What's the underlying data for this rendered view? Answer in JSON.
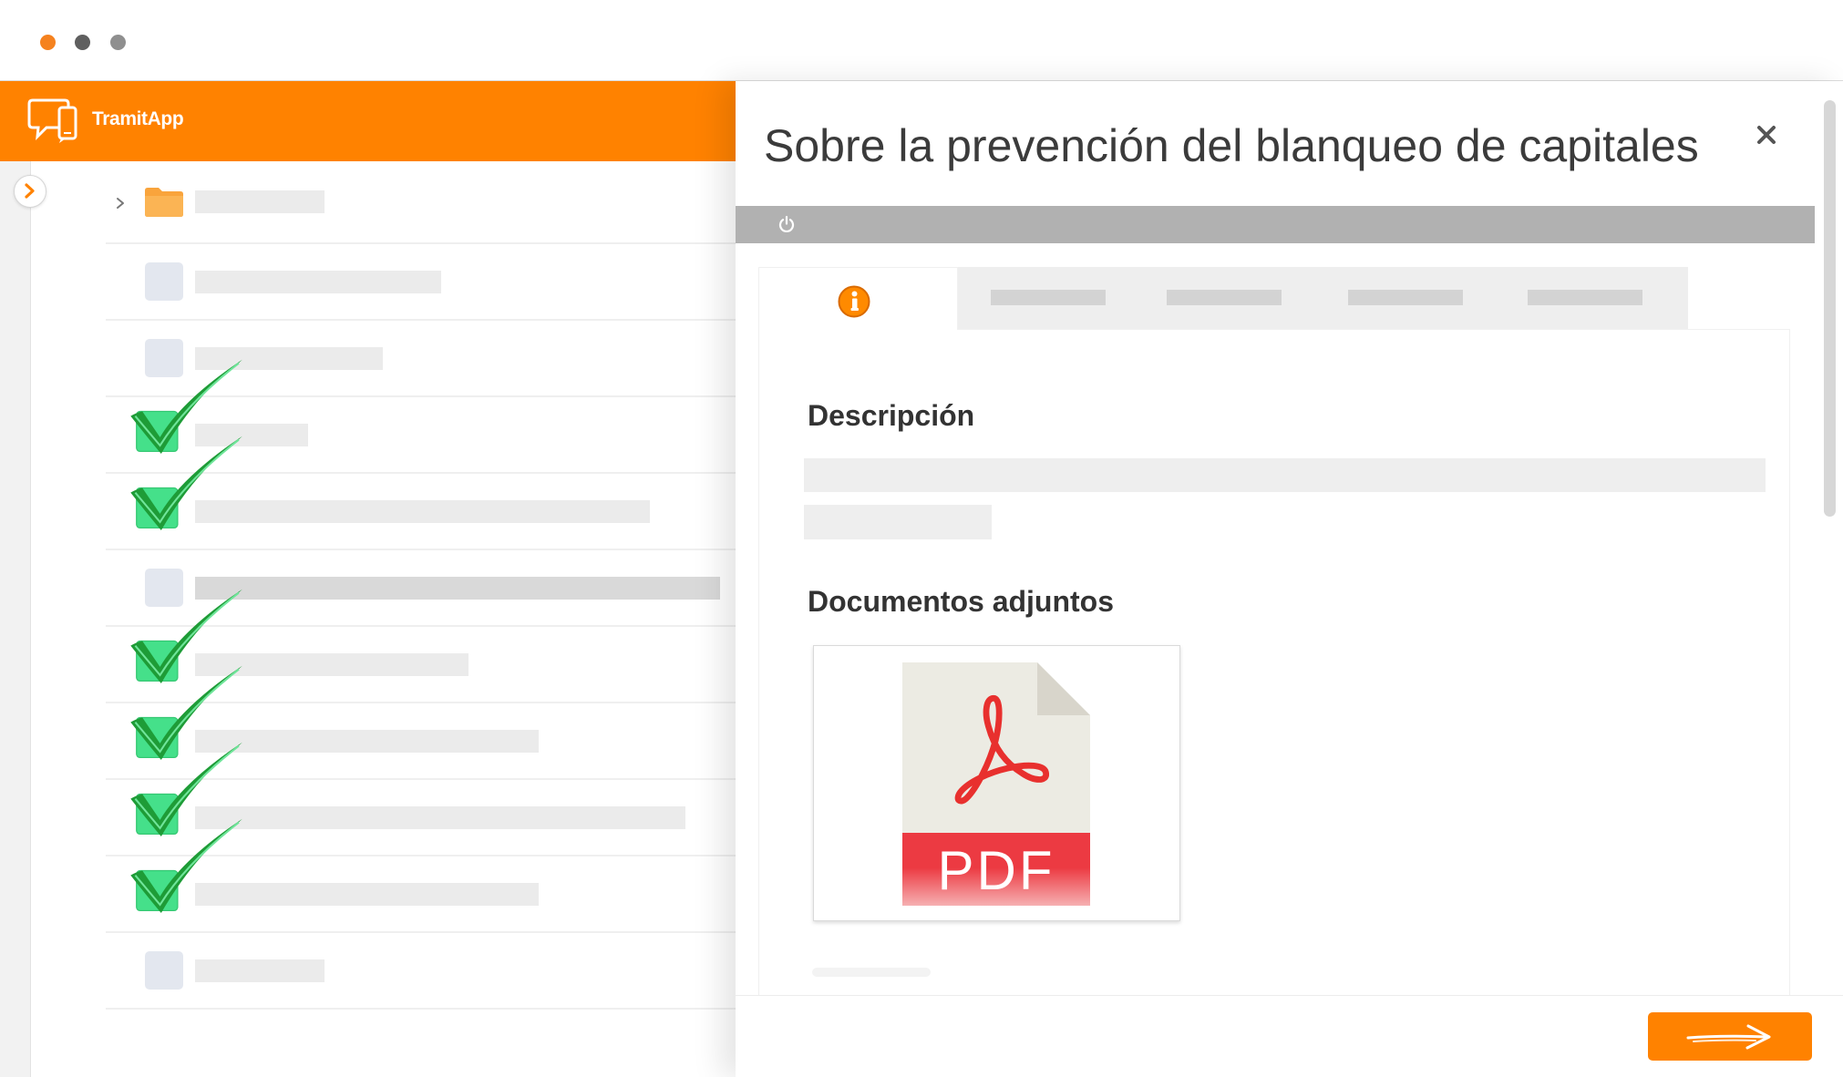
{
  "window": {
    "dot_colors": [
      "#f5821f",
      "#5f5f5f",
      "#8f8f8f"
    ]
  },
  "brand": {
    "name": "TramitApp",
    "logo_icon": "speech-bubbles-icon"
  },
  "sidebar": {
    "toggle_icon": "chevron-right-icon"
  },
  "list": {
    "items": [
      {
        "folder": true,
        "checked": false
      },
      {
        "folder": false,
        "checked": false
      },
      {
        "folder": false,
        "checked": false
      },
      {
        "folder": false,
        "checked": true
      },
      {
        "folder": false,
        "checked": true
      },
      {
        "folder": false,
        "checked": false
      },
      {
        "folder": false,
        "checked": true
      },
      {
        "folder": false,
        "checked": true
      },
      {
        "folder": false,
        "checked": true
      },
      {
        "folder": false,
        "checked": true
      },
      {
        "folder": false,
        "checked": false
      }
    ]
  },
  "detail": {
    "title": "Sobre la prevención del blanqueo de capitales",
    "close_icon": "close-icon",
    "toolbar": {
      "icon": "power-icon"
    },
    "tabs": [
      {
        "icon": "info-icon",
        "active": true
      },
      {
        "active": false
      },
      {
        "active": false
      },
      {
        "active": false
      },
      {
        "active": false
      }
    ],
    "description": {
      "heading": "Descripción"
    },
    "attachments": {
      "heading": "Documentos adjuntos",
      "files": [
        {
          "type_label": "PDF",
          "icon": "pdf-file-icon"
        }
      ]
    }
  },
  "footer": {
    "next_icon": "arrow-right-icon"
  },
  "colors": {
    "accent": "#ff8200",
    "toolbar": "#b1b1b1",
    "check_box": "#45e08a",
    "tick": "#1e9c37",
    "pdf": "#ec3a42",
    "folder": "#f9a43c"
  }
}
